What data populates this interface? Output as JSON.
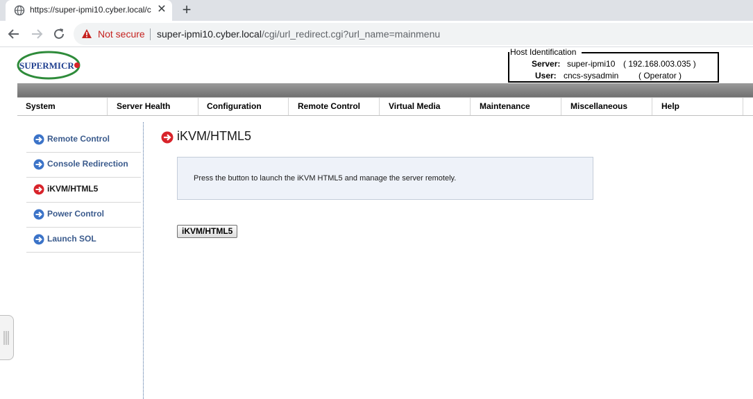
{
  "browser": {
    "tab_title": "https://super-ipmi10.cyber.local/c",
    "tab_close": "✕",
    "new_tab": "+",
    "not_secure": "Not secure",
    "url_host": "super-ipmi10.cyber.local",
    "url_path": "/cgi/url_redirect.cgi?url_name=mainmenu"
  },
  "header": {
    "logo_text": "SUPERMICRO",
    "host_identification": {
      "legend": "Host Identification",
      "server_label": "Server:",
      "server_value": "super-ipmi10",
      "server_ip": "( 192.168.003.035 )",
      "user_label": "User:",
      "user_value": "cncs-sysadmin",
      "user_role": "( Operator )"
    }
  },
  "menu": [
    {
      "label": "System"
    },
    {
      "label": "Server Health"
    },
    {
      "label": "Configuration"
    },
    {
      "label": "Remote Control"
    },
    {
      "label": "Virtual Media"
    },
    {
      "label": "Maintenance"
    },
    {
      "label": "Miscellaneous"
    },
    {
      "label": "Help"
    }
  ],
  "sidebar": {
    "items": [
      {
        "label": "Remote Control",
        "active": false
      },
      {
        "label": "Console Redirection",
        "active": false
      },
      {
        "label": "iKVM/HTML5",
        "active": true
      },
      {
        "label": "Power Control",
        "active": false
      },
      {
        "label": "Launch SOL",
        "active": false
      }
    ]
  },
  "main": {
    "title": "iKVM/HTML5",
    "info_text": "Press the button to launch the iKVM HTML5 and manage the server remotely.",
    "launch_button": "iKVM/HTML5"
  },
  "colors": {
    "nav_arrow_blue": "#3b73c8",
    "nav_arrow_red": "#d8232a",
    "logo_green": "#2e8b3a",
    "logo_blue": "#1f3f8f",
    "not_secure_red": "#c5221f"
  },
  "icons": {
    "favicon": "globe-icon",
    "warning": "warning-triangle-icon",
    "nav_default": "arrow-circle-blue-icon",
    "nav_active": "arrow-circle-red-icon"
  }
}
